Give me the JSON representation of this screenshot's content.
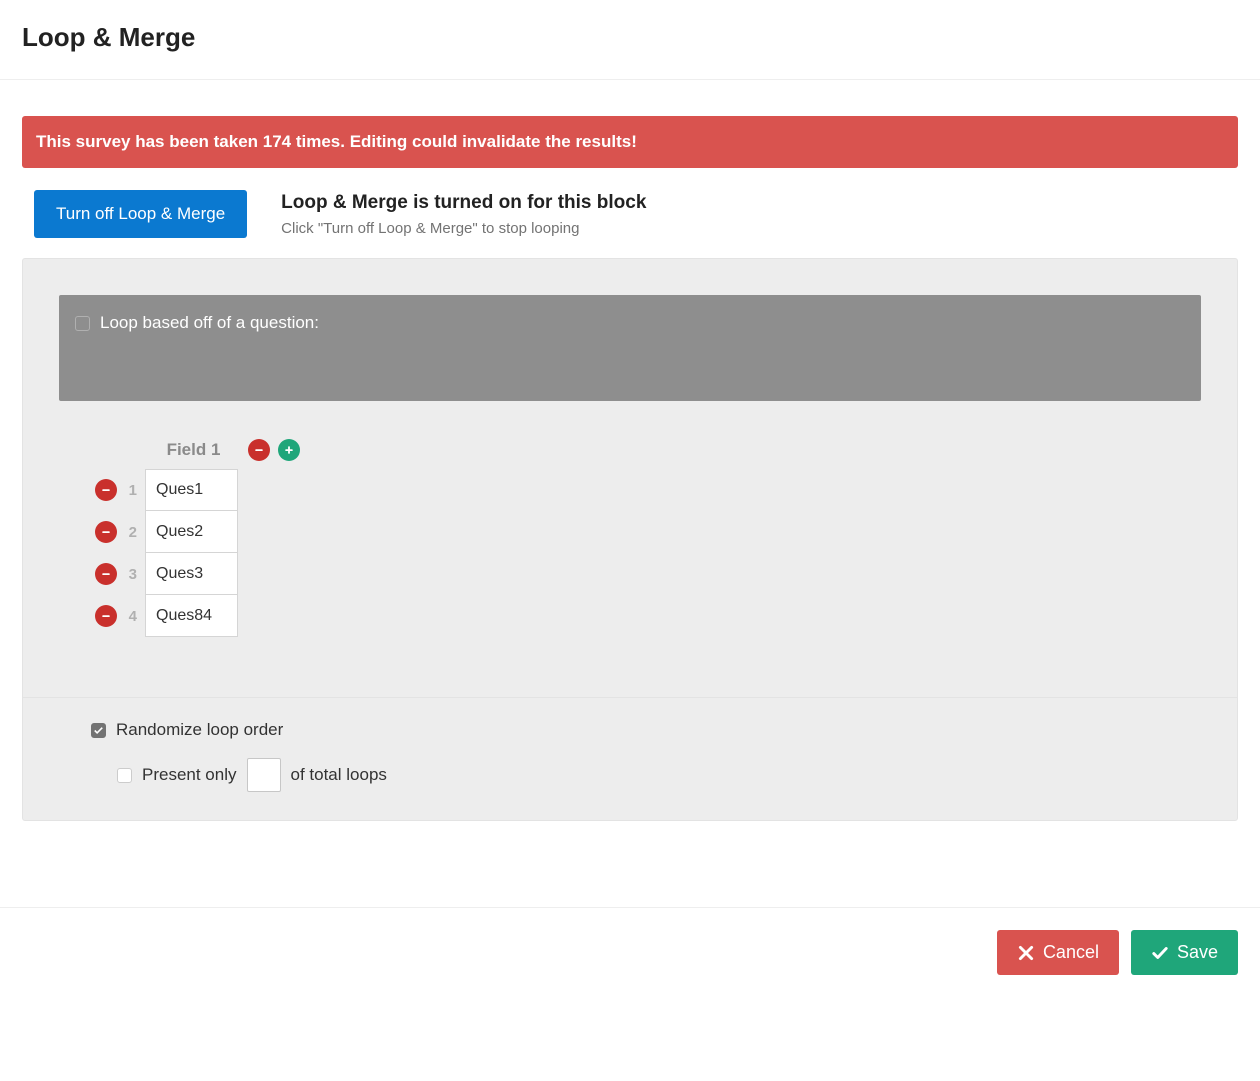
{
  "title": "Loop & Merge",
  "alert": "This survey has been taken 174 times. Editing could invalidate the results!",
  "toggle": {
    "button": "Turn off Loop & Merge",
    "heading": "Loop & Merge is turned on for this block",
    "sub": "Click \"Turn off Loop & Merge\" to stop looping"
  },
  "questionLoop": {
    "label": "Loop based off of a question:"
  },
  "fields": {
    "header": "Field 1",
    "rows": [
      "Ques1",
      "Ques2",
      "Ques3",
      "Ques84"
    ]
  },
  "options": {
    "randomize": "Randomize loop order",
    "presentPre": "Present only",
    "presentPost": "of total loops",
    "presentValue": ""
  },
  "footer": {
    "cancel": "Cancel",
    "save": "Save"
  }
}
